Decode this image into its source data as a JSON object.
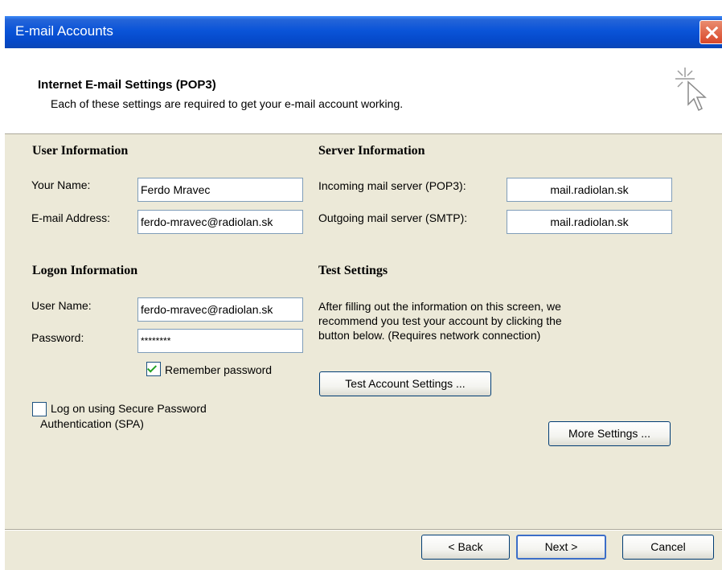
{
  "window": {
    "title": "E-mail Accounts"
  },
  "header": {
    "title": "Internet E-mail Settings (POP3)",
    "subtitle": "Each of these settings are required to get your e-mail account working."
  },
  "user_info": {
    "heading": "User Information",
    "name_label": "Your Name:",
    "name_value": "Ferdo Mravec",
    "email_label": "E-mail Address:",
    "email_value": "ferdo-mravec@radiolan.sk"
  },
  "server_info": {
    "heading": "Server Information",
    "incoming_label": "Incoming mail server (POP3):",
    "incoming_value": "mail.radiolan.sk",
    "outgoing_label": "Outgoing mail server (SMTP):",
    "outgoing_value": "mail.radiolan.sk"
  },
  "logon_info": {
    "heading": "Logon Information",
    "username_label": "User Name:",
    "username_value": "ferdo-mravec@radiolan.sk",
    "password_label": "Password:",
    "password_value": "********",
    "remember_label": "Remember password",
    "remember_checked": true,
    "spa_label_line1": "Log on using Secure Password",
    "spa_label_line2": "Authentication (SPA)",
    "spa_checked": false
  },
  "test_settings": {
    "heading": "Test Settings",
    "desc_line1": "After filling out the information on this screen, we",
    "desc_line2": "recommend you test your account by clicking the",
    "desc_line3": "button below. (Requires network connection)",
    "test_button": "Test Account Settings ..."
  },
  "more_settings_button": "More Settings ...",
  "footer": {
    "back": "< Back",
    "next": "Next >",
    "cancel": "Cancel"
  }
}
